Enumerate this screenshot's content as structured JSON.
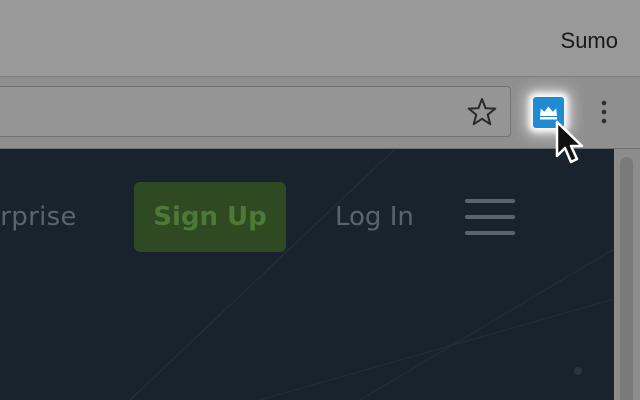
{
  "browser": {
    "profile_name": "Sumo"
  },
  "toolbar": {
    "bookmark_icon": "star-icon",
    "extension_icon": "crown-icon",
    "extension_color": "#1f8bd0",
    "menu_icon": "vertical-dots-icon"
  },
  "site_nav": {
    "enterprise_label": "erprise",
    "signup_label": "Sign Up",
    "login_label": "Log In",
    "menu_icon": "hamburger-icon",
    "signup_color": "#2f4a23",
    "background_color": "#18232d"
  },
  "pointer": {
    "icon": "mouse-pointer-icon"
  }
}
